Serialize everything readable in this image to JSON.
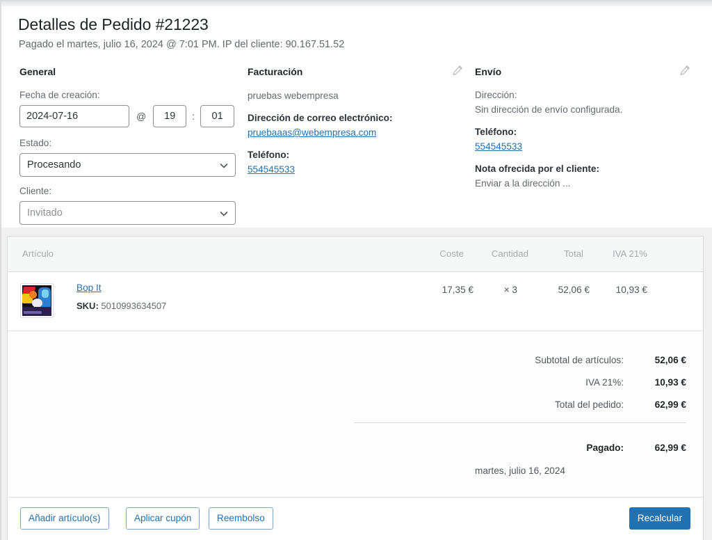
{
  "header": {
    "title": "Detalles de Pedido #21223",
    "subtitle": "Pagado el martes, julio 16, 2024 @ 7:01 PM. IP del cliente: 90.167.51.52"
  },
  "general": {
    "heading": "General",
    "date_label": "Fecha de creación:",
    "date_value": "2024-07-16",
    "at_separator": "@",
    "hour_value": "19",
    "colon_separator": ":",
    "minute_value": "01",
    "status_label": "Estado:",
    "status_value": "Procesando",
    "customer_label": "Cliente:",
    "customer_value": "Invitado"
  },
  "billing": {
    "heading": "Facturación",
    "edit_icon": "pencil-icon",
    "name": "pruebas webempresa",
    "email_label": "Dirección de correo electrónico:",
    "email_value": "pruebaaas@webempresa.com",
    "phone_label": "Teléfono:",
    "phone_value": "554545533"
  },
  "shipping": {
    "heading": "Envío",
    "edit_icon": "pencil-icon",
    "address_label": "Dirección:",
    "address_value": "Sin dirección de envío configurada.",
    "phone_label": "Teléfono:",
    "phone_value": "554545533",
    "note_label": "Nota ofrecida por el cliente:",
    "note_value": "Enviar a la dirección ..."
  },
  "items": {
    "columns": {
      "item": "Artículo",
      "cost": "Coste",
      "qty": "Cantidad",
      "total": "Total",
      "tax": "IVA 21%"
    },
    "rows": [
      {
        "name": "Bop It",
        "sku_label": "SKU:",
        "sku_value": "5010993634507",
        "cost": "17,35 €",
        "qty": "× 3",
        "total": "52,06 €",
        "tax": "10,93 €"
      }
    ]
  },
  "totals": {
    "subtotal_label": "Subtotal de artículos:",
    "subtotal_value": "52,06 €",
    "tax_label": "IVA 21%:",
    "tax_value": "10,93 €",
    "order_total_label": "Total del pedido:",
    "order_total_value": "62,99 €",
    "paid_label": "Pagado:",
    "paid_value": "62,99 €",
    "paid_date": "martes, julio 16, 2024"
  },
  "actions": {
    "add_items": "Añadir artículo(s)",
    "apply_coupon": "Aplicar cupón",
    "refund": "Reembolso",
    "recalculate": "Recalcular"
  },
  "colors": {
    "accent": "#2271b1",
    "page_bg": "#f0f0f1",
    "panel_bg": "#ffffff",
    "text_dark": "#1d2327",
    "text_muted": "#646970"
  }
}
